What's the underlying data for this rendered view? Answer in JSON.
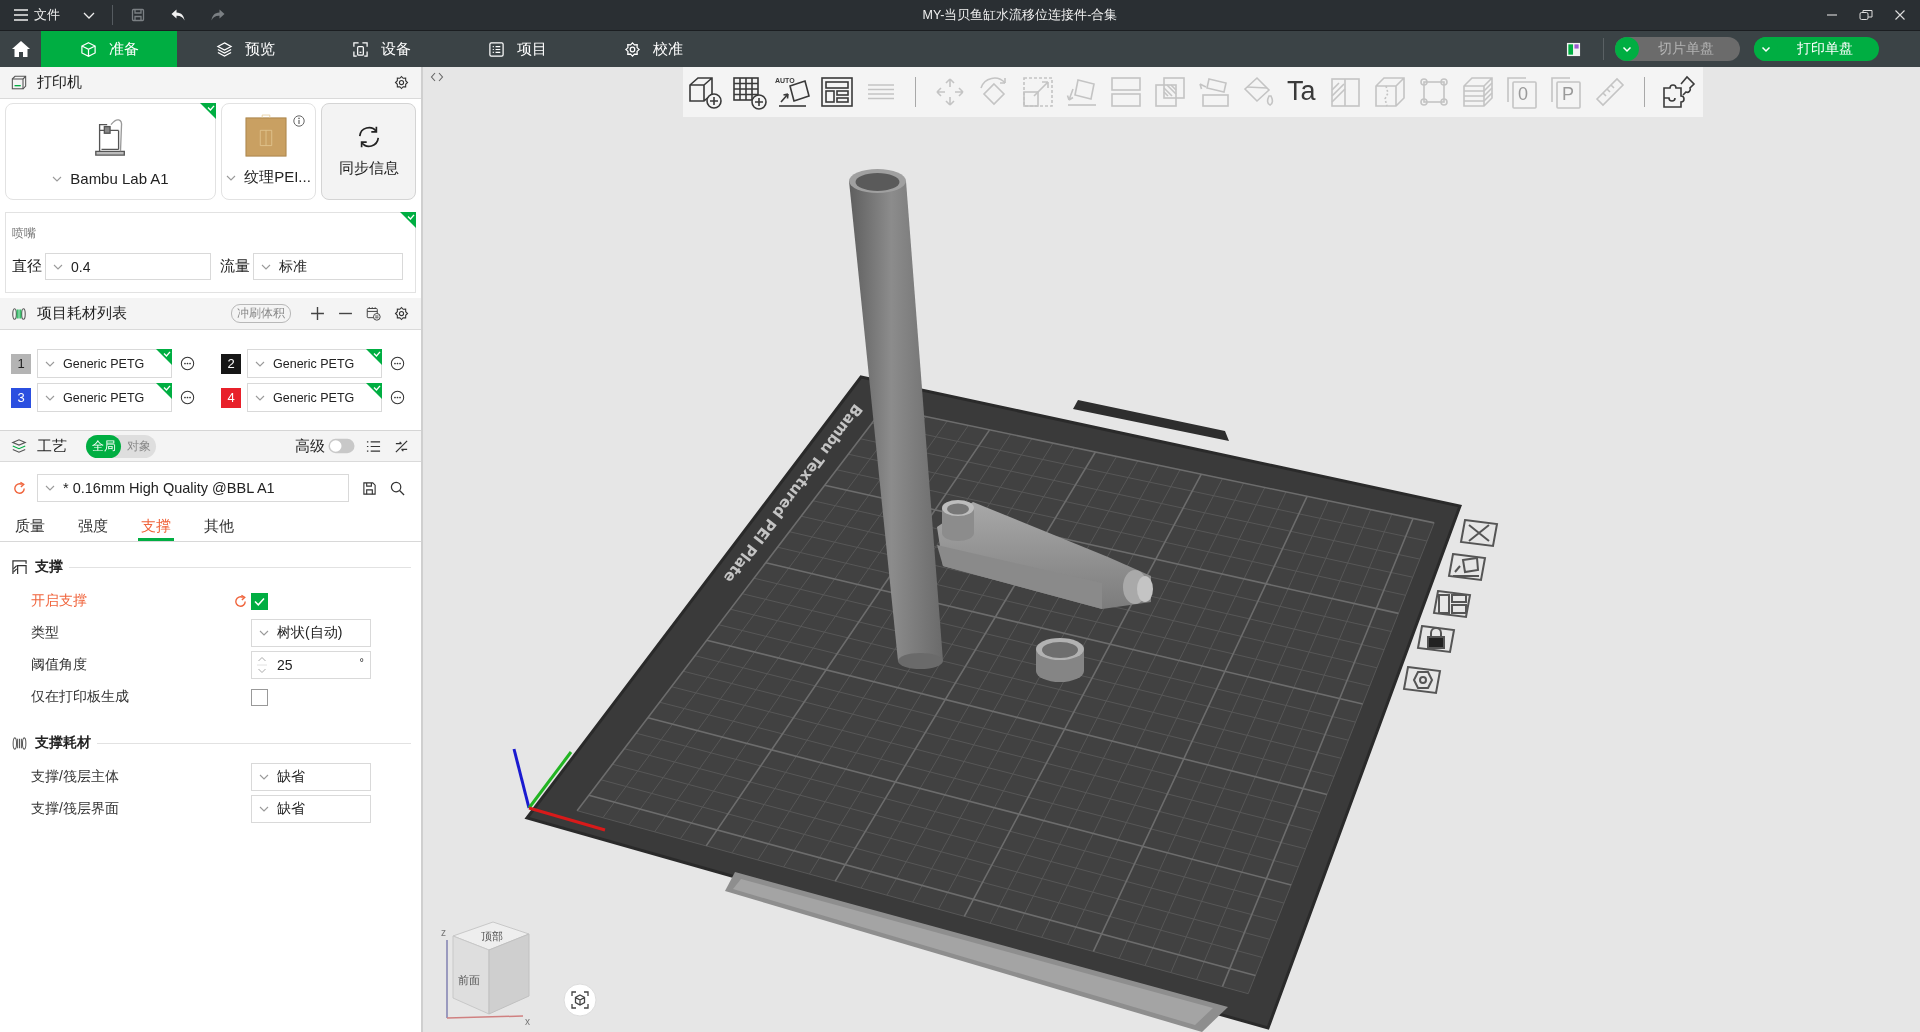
{
  "title_bar": {
    "menu": "文件",
    "quick_actions": [
      {
        "kind": "save",
        "disabled": true
      },
      {
        "kind": "undo",
        "disabled": false
      },
      {
        "kind": "redo",
        "disabled": true
      }
    ],
    "title": "MY-当贝鱼缸水流移位连接件-合集"
  },
  "main_tabs": [
    {
      "kind": "prepare",
      "label": "准备",
      "selected": true
    },
    {
      "kind": "preview",
      "label": "预览",
      "selected": false
    },
    {
      "kind": "device",
      "label": "设备",
      "selected": false
    },
    {
      "kind": "project",
      "label": "项目",
      "selected": false
    },
    {
      "kind": "calibrate",
      "label": "校准",
      "selected": false
    }
  ],
  "actions": [
    {
      "label": "切片单盘",
      "disabled": true
    },
    {
      "label": "打印单盘",
      "disabled": false
    }
  ],
  "printer": {
    "title": "打印机",
    "model": {
      "label": "Bambu Lab A1",
      "synced": true
    },
    "plate": {
      "label": "纹理PEI..."
    },
    "sync": {
      "label": "同步信息"
    }
  },
  "nozzle": {
    "title": "喷嘴",
    "synced": true,
    "fields": [
      {
        "label": "直径",
        "value": "0.4"
      },
      {
        "label": "流量",
        "value": "标准"
      }
    ]
  },
  "filaments": {
    "title": "项目耗材列表",
    "badge": "冲刷体积",
    "items": [
      {
        "number": "1",
        "color": "#b4b4b4",
        "name": "Generic PETG",
        "synced": true
      },
      {
        "number": "2",
        "color": "#161616",
        "name": "Generic PETG",
        "synced": true
      },
      {
        "number": "3",
        "color": "#2b4fe0",
        "name": "Generic PETG",
        "synced": true
      },
      {
        "number": "4",
        "color": "#e8202a",
        "name": "Generic PETG",
        "synced": true
      }
    ]
  },
  "process": {
    "title": "工艺",
    "scope": [
      {
        "label": "全局",
        "selected": true
      },
      {
        "label": "对象",
        "selected": false
      }
    ],
    "advanced": {
      "label": "高级",
      "on": false
    },
    "preset": {
      "value": "* 0.16mm High Quality @BBL A1",
      "modified": true
    },
    "tabs": [
      {
        "label": "质量",
        "selected": false,
        "modified": false
      },
      {
        "label": "强度",
        "selected": false,
        "modified": false
      },
      {
        "label": "支撑",
        "selected": true,
        "modified": true
      },
      {
        "label": "其他",
        "selected": false,
        "modified": false
      }
    ],
    "groups": [
      {
        "kind": "support",
        "title": "支撑",
        "options": [
          {
            "kind": "checkbox",
            "label": "开启支撑",
            "checked": true,
            "modified": true
          },
          {
            "kind": "select",
            "label": "类型",
            "value": "树状(自动)",
            "modified": false
          },
          {
            "kind": "spin",
            "label": "阈值角度",
            "value": "25",
            "unit": "°",
            "modified": false
          },
          {
            "kind": "checkbox",
            "label": "仅在打印板生成",
            "checked": false,
            "modified": false
          }
        ]
      },
      {
        "kind": "filament",
        "title": "支撑耗材",
        "options": [
          {
            "kind": "select",
            "label": "支撑/筏层主体",
            "value": "缺省",
            "modified": false
          },
          {
            "kind": "select",
            "label": "支撑/筏层界面",
            "value": "缺省",
            "modified": false
          }
        ]
      }
    ]
  },
  "toolbar": {
    "groups": [
      [
        {
          "kind": "cube",
          "disabled": false
        },
        {
          "kind": "grid",
          "disabled": false
        },
        {
          "kind": "orient",
          "disabled": false,
          "label": "AUTO"
        },
        {
          "kind": "arrange",
          "disabled": false
        },
        {
          "kind": "layers",
          "disabled": true
        }
      ],
      [
        {
          "kind": "move",
          "disabled": true
        },
        {
          "kind": "rotate",
          "disabled": true
        },
        {
          "kind": "scale",
          "disabled": true
        },
        {
          "kind": "lay",
          "disabled": true
        },
        {
          "kind": "cut",
          "disabled": true
        },
        {
          "kind": "boolean",
          "disabled": true
        },
        {
          "kind": "paint",
          "disabled": true
        },
        {
          "kind": "bucket",
          "disabled": true
        },
        {
          "kind": "text",
          "disabled": false,
          "label": "Ta"
        },
        {
          "kind": "fuzzy",
          "disabled": true
        },
        {
          "kind": "seam",
          "disabled": true
        },
        {
          "kind": "frame",
          "disabled": true
        },
        {
          "kind": "slices",
          "disabled": true
        },
        {
          "kind": "pages",
          "disabled": true,
          "label": "0"
        },
        {
          "kind": "pages",
          "disabled": true,
          "label": "P"
        },
        {
          "kind": "ruler",
          "disabled": true
        }
      ],
      [
        {
          "kind": "puzzle",
          "disabled": false
        }
      ]
    ]
  },
  "viewport": {
    "plate_label": "Bambu Textured PEI Plate",
    "view_cube": {
      "top": "顶部",
      "front": "前面",
      "axis_z": "z",
      "axis_x": "x"
    }
  }
}
